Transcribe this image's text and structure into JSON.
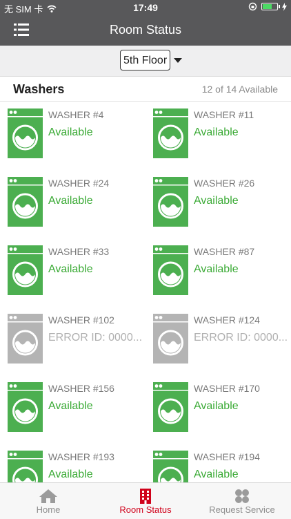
{
  "status_bar": {
    "carrier": "无 SIM 卡",
    "time": "17:49",
    "battery_percent": 70
  },
  "header": {
    "title": "Room Status"
  },
  "floor": {
    "selected": "5th Floor"
  },
  "section": {
    "title": "Washers",
    "count": "12 of 14 Available"
  },
  "washers": [
    {
      "name": "WASHER #4",
      "status": "Available",
      "state": "available"
    },
    {
      "name": "WASHER #11",
      "status": "Available",
      "state": "available"
    },
    {
      "name": "WASHER #24",
      "status": "Available",
      "state": "available"
    },
    {
      "name": "WASHER #26",
      "status": "Available",
      "state": "available"
    },
    {
      "name": "WASHER #33",
      "status": "Available",
      "state": "available"
    },
    {
      "name": "WASHER #87",
      "status": "Available",
      "state": "available"
    },
    {
      "name": "WASHER #102",
      "status": "ERROR ID: 0000...",
      "state": "error"
    },
    {
      "name": "WASHER #124",
      "status": "ERROR ID: 0000...",
      "state": "error"
    },
    {
      "name": "WASHER #156",
      "status": "Available",
      "state": "available"
    },
    {
      "name": "WASHER #170",
      "status": "Available",
      "state": "available"
    },
    {
      "name": "WASHER #193",
      "status": "Available",
      "state": "available"
    },
    {
      "name": "WASHER #194",
      "status": "Available",
      "state": "available"
    }
  ],
  "colors": {
    "available": "#4caf50",
    "error": "#b4b4b4",
    "accent": "#d0021b",
    "header_bg": "#58585a"
  },
  "tabs": [
    {
      "label": "Home",
      "icon": "house-icon",
      "active": false
    },
    {
      "label": "Room Status",
      "icon": "building-icon",
      "active": true
    },
    {
      "label": "Request Service",
      "icon": "clover-icon",
      "active": false
    }
  ]
}
